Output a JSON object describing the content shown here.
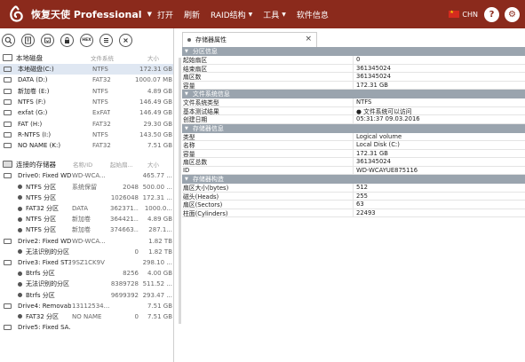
{
  "titlebar": {
    "app_title": "恢复天使 Professional",
    "menu": [
      {
        "label": "打开"
      },
      {
        "label": "刷新"
      },
      {
        "label": "RAID结构",
        "has_dropdown": true
      },
      {
        "label": "工具",
        "has_dropdown": true
      },
      {
        "label": "软件信息"
      }
    ],
    "language": "CHN",
    "bg_color": "#8b2a1c"
  },
  "toolbar": {
    "icons": [
      "search-icon",
      "scan-icon",
      "recover-icon",
      "lock-icon",
      "hex-icon",
      "list-icon",
      "close-icon"
    ],
    "hex_label": "HEX"
  },
  "local_disks": {
    "header": "本地磁盘",
    "col_fs": "文件系统",
    "col_size": "大小",
    "rows": [
      {
        "name": "本地磁盘(C:)",
        "fs": "NTFS",
        "size": "172.31 GB",
        "selected": true
      },
      {
        "name": "DATA (D:)",
        "fs": "FAT32",
        "size": "1000.07 MB"
      },
      {
        "name": "新加卷 (E:)",
        "fs": "NTFS",
        "size": "4.89 GB"
      },
      {
        "name": "NTFS (F:)",
        "fs": "NTFS",
        "size": "146.49 GB"
      },
      {
        "name": "exfat (G:)",
        "fs": "ExFAT",
        "size": "146.49 GB"
      },
      {
        "name": "FAT (H:)",
        "fs": "FAT32",
        "size": "29.30 GB"
      },
      {
        "name": "R-NTFS (I:)",
        "fs": "NTFS",
        "size": "143.50 GB"
      },
      {
        "name": "NO NAME (K:)",
        "fs": "FAT32",
        "size": "7.51 GB"
      }
    ]
  },
  "storage": {
    "header": "连接的存储器",
    "col_name": "名称/ID",
    "col_start": "起始扇...",
    "col_size": "大小",
    "rows": [
      {
        "kind": "drive",
        "c1": "Drive0: Fixed WD...",
        "c2": "WD-WCA...",
        "c3": "",
        "c4": "465.77 ..."
      },
      {
        "kind": "part",
        "c1": "NTFS 分区",
        "c2": "系统保留",
        "c3": "2048",
        "c4": "500.00 ..."
      },
      {
        "kind": "part",
        "c1": "NTFS 分区",
        "c2": "",
        "c3": "1026048",
        "c4": "172.31 ..."
      },
      {
        "kind": "part",
        "c1": "FAT32 分区",
        "c2": "DATA",
        "c3": "362371...",
        "c4": "1000.0..."
      },
      {
        "kind": "part",
        "c1": "NTFS 分区",
        "c2": "新加卷",
        "c3": "364421...",
        "c4": "4.89 GB"
      },
      {
        "kind": "part",
        "c1": "NTFS 分区",
        "c2": "新加卷",
        "c3": "374663...",
        "c4": "287.1..."
      },
      {
        "kind": "drive",
        "c1": "Drive2: Fixed WD...",
        "c2": "WD-WCA...",
        "c3": "",
        "c4": "1.82 TB"
      },
      {
        "kind": "part",
        "c1": "无法识别的分区",
        "c2": "",
        "c3": "0",
        "c4": "1.82 TB"
      },
      {
        "kind": "drive",
        "c1": "Drive3: Fixed ST3...",
        "c2": "9SZ1CK9V",
        "c3": "",
        "c4": "298.10 ..."
      },
      {
        "kind": "part",
        "c1": "Btrfs 分区",
        "c2": "",
        "c3": "8256",
        "c4": "4.00 GB"
      },
      {
        "kind": "part",
        "c1": "无法识别的分区",
        "c2": "",
        "c3": "8389728",
        "c4": "511.52 ..."
      },
      {
        "kind": "part",
        "c1": "Btrfs 分区",
        "c2": "",
        "c3": "9699392",
        "c4": "293.47 ..."
      },
      {
        "kind": "drive",
        "c1": "Drive4: Removabl...",
        "c2": "13112534...",
        "c3": "",
        "c4": "7.51 GB"
      },
      {
        "kind": "part",
        "c1": "FAT32 分区",
        "c2": "NO NAME",
        "c3": "0",
        "c4": "7.51 GB"
      },
      {
        "kind": "drive",
        "c1": "Drive5: Fixed SA...",
        "c2": "",
        "c3": "",
        "c4": ""
      }
    ]
  },
  "props": {
    "tab_label": "存储器属性",
    "sections": [
      {
        "title": "分区信息",
        "rows": [
          {
            "k": "起始扇区",
            "v": "0"
          },
          {
            "k": "结束扇区",
            "v": "361345024"
          },
          {
            "k": "扇区数",
            "v": "361345024"
          },
          {
            "k": "容量",
            "v": "172.31 GB"
          }
        ]
      },
      {
        "title": "文件系统信息",
        "rows": [
          {
            "k": "文件系统类型",
            "v": "NTFS"
          },
          {
            "k": "基本测试结果",
            "v": "● 文件系统可以访问"
          },
          {
            "k": "创建日期",
            "v": "05:31:37 09.03.2016"
          }
        ]
      },
      {
        "title": "存储器信息",
        "rows": [
          {
            "k": "类型",
            "v": "Logical volume"
          },
          {
            "k": "名称",
            "v": "Local Disk (C:)"
          },
          {
            "k": "容量",
            "v": "172.31 GB"
          },
          {
            "k": "扇区总数",
            "v": "361345024"
          },
          {
            "k": "ID",
            "v": "WD-WCAYUE875116"
          }
        ]
      },
      {
        "title": "存储器构造",
        "rows": [
          {
            "k": "扇区大小(bytes)",
            "v": "512"
          },
          {
            "k": "磁头(Heads)",
            "v": "255"
          },
          {
            "k": "扇区(Sectors)",
            "v": "63"
          },
          {
            "k": "柱面(Cylinders)",
            "v": "22493"
          }
        ]
      }
    ]
  }
}
